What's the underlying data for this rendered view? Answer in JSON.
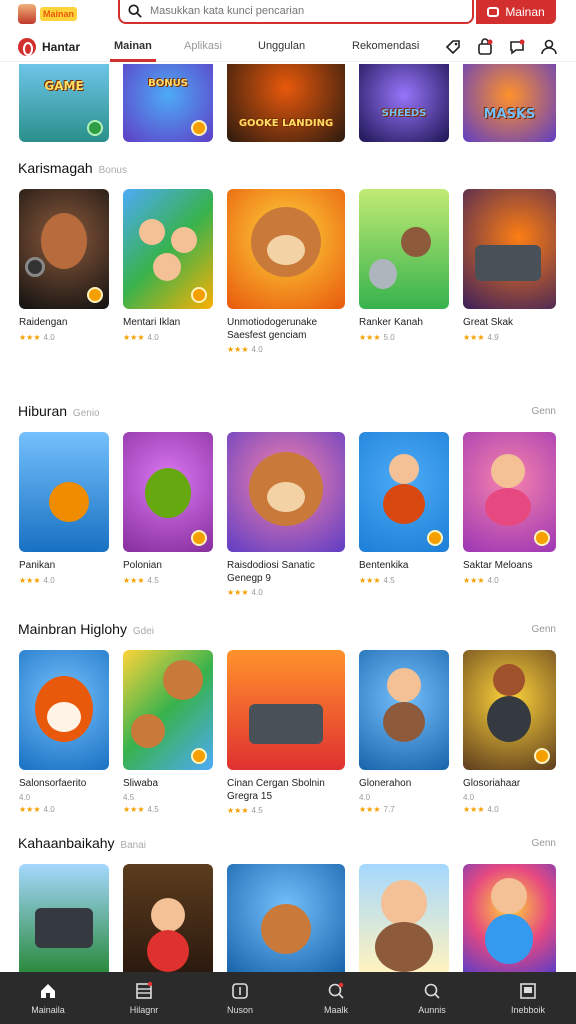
{
  "header": {
    "logo_text": "Mainan",
    "search_placeholder": "Masukkan kata kunci pencarian",
    "search_button": "Mainan"
  },
  "nav": {
    "brand": "Hantar",
    "tabs": [
      "Mainan",
      "Aplikasi",
      "Unggulan",
      "Rekomendasi"
    ]
  },
  "top_row": {
    "cards": [
      {
        "title": "GAME"
      },
      {
        "title": "BONUS"
      },
      {
        "title": "GOOKE LANDING"
      },
      {
        "title": "SHEEDS"
      },
      {
        "title": "MASKS"
      }
    ]
  },
  "sections": [
    {
      "title": "Karismagah",
      "subtitle": "Bonus",
      "more": "",
      "cards": [
        {
          "name": "Raidengan",
          "meta": "",
          "rating": "4.0"
        },
        {
          "name": "Mentari Iklan",
          "meta": "",
          "rating": "4.0"
        },
        {
          "name": "Unmotiodogerunake Saesfest genciam",
          "meta": "",
          "rating": "4.0"
        },
        {
          "name": "Ranker Kanah",
          "meta": "",
          "rating": "5.0"
        },
        {
          "name": "Great Skak",
          "meta": "",
          "rating": "4.9"
        }
      ]
    },
    {
      "title": "Hiburan",
      "subtitle": "Genio",
      "more": "Genn",
      "cards": [
        {
          "name": "Panikan",
          "meta": "",
          "rating": "4.0"
        },
        {
          "name": "Polonian",
          "meta": "",
          "rating": "4.5"
        },
        {
          "name": "Raisdodiosi Sanatic Genegp 9",
          "meta": "",
          "rating": "4.0"
        },
        {
          "name": "Bentenkika",
          "meta": "",
          "rating": "4.5"
        },
        {
          "name": "Saktar Meloans",
          "meta": "",
          "rating": "4.0"
        }
      ]
    },
    {
      "title": "Mainbran Higlohy",
      "subtitle": "Gdei",
      "more": "Genn",
      "cards": [
        {
          "name": "Salonsorfaerito",
          "meta": "4.0",
          "rating": "4.0"
        },
        {
          "name": "Sliwaba",
          "meta": "4.5",
          "rating": "4.5"
        },
        {
          "name": "Cinan Cergan Sbolnin Gregra 15",
          "meta": "",
          "rating": "4.5"
        },
        {
          "name": "Glonerahon",
          "meta": "4.0",
          "rating": "7.7"
        },
        {
          "name": "Glosoriahaar",
          "meta": "4.0",
          "rating": "4.0"
        }
      ]
    },
    {
      "title": "Kahaanbaikahy",
      "subtitle": "Banai",
      "more": "Genn",
      "cards": [
        {
          "name": "",
          "meta": "",
          "rating": ""
        },
        {
          "name": "",
          "meta": "",
          "rating": ""
        },
        {
          "name": "",
          "meta": "",
          "rating": ""
        },
        {
          "name": "",
          "meta": "",
          "rating": ""
        },
        {
          "name": "",
          "meta": "",
          "rating": ""
        }
      ]
    }
  ],
  "bottom_nav": [
    "Mainaila",
    "Hilagnr",
    "Nuson",
    "Maalk",
    "Aunnis",
    "Inebboik"
  ]
}
